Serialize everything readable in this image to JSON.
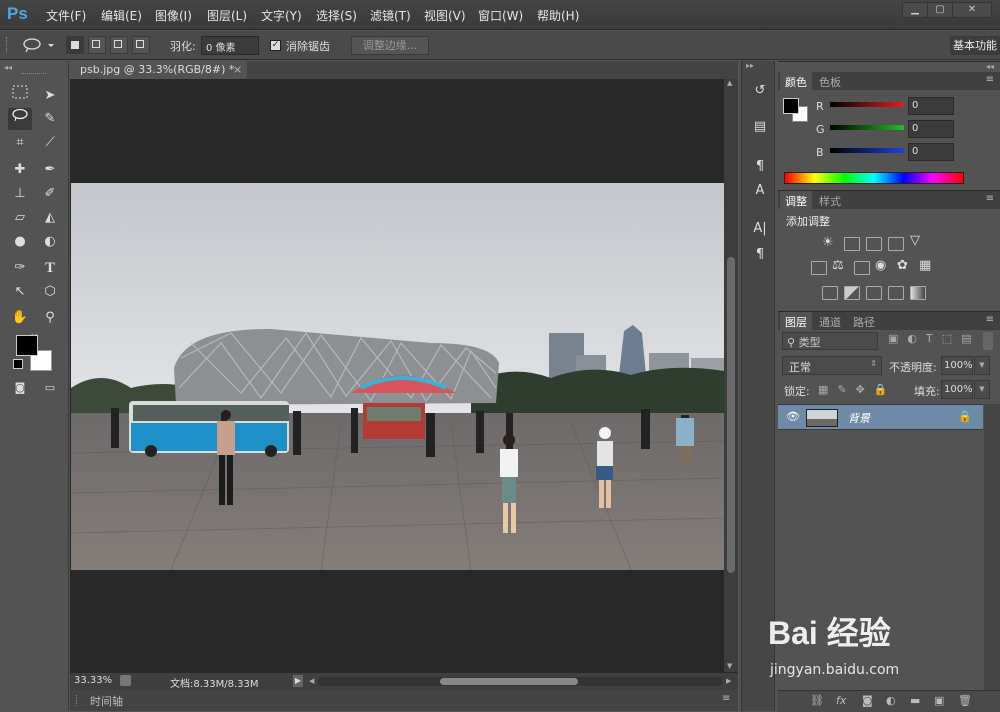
{
  "app": {
    "logo": "Ps"
  },
  "menu": [
    "文件(F)",
    "编辑(E)",
    "图像(I)",
    "图层(L)",
    "文字(Y)",
    "选择(S)",
    "滤镜(T)",
    "视图(V)",
    "窗口(W)",
    "帮助(H)"
  ],
  "window_controls": [
    "▁",
    "▢",
    "✕"
  ],
  "options": {
    "feather_label": "羽化:",
    "feather_value": "0 像素",
    "antialias_label": "消除锯齿",
    "refine_edge": "调整边缘...",
    "workspace": "基本功能"
  },
  "document": {
    "tab_title": "psb.jpg @ 33.3%(RGB/8#) *",
    "zoom": "33.33%",
    "doc_info": "文档:8.33M/8.33M"
  },
  "timeline": {
    "label": "时间轴"
  },
  "color_panel": {
    "tabs": [
      "颜色",
      "色板"
    ],
    "channels": [
      {
        "name": "R",
        "value": "0",
        "color": "#e03030"
      },
      {
        "name": "G",
        "value": "0",
        "color": "#30c030"
      },
      {
        "name": "B",
        "value": "0",
        "color": "#3050e0"
      }
    ]
  },
  "adjust_panel": {
    "tabs": [
      "调整",
      "样式"
    ],
    "title": "添加调整"
  },
  "layers_panel": {
    "tabs": [
      "图层",
      "通道",
      "路径"
    ],
    "filter_kind": "类型",
    "blend_mode": "正常",
    "opacity_label": "不透明度:",
    "opacity_value": "100%",
    "lock_label": "锁定:",
    "fill_label": "填充:",
    "fill_value": "100%",
    "layer_name": "背景"
  },
  "watermark": {
    "brand": "Bai 经验",
    "url": "jingyan.baidu.com"
  }
}
